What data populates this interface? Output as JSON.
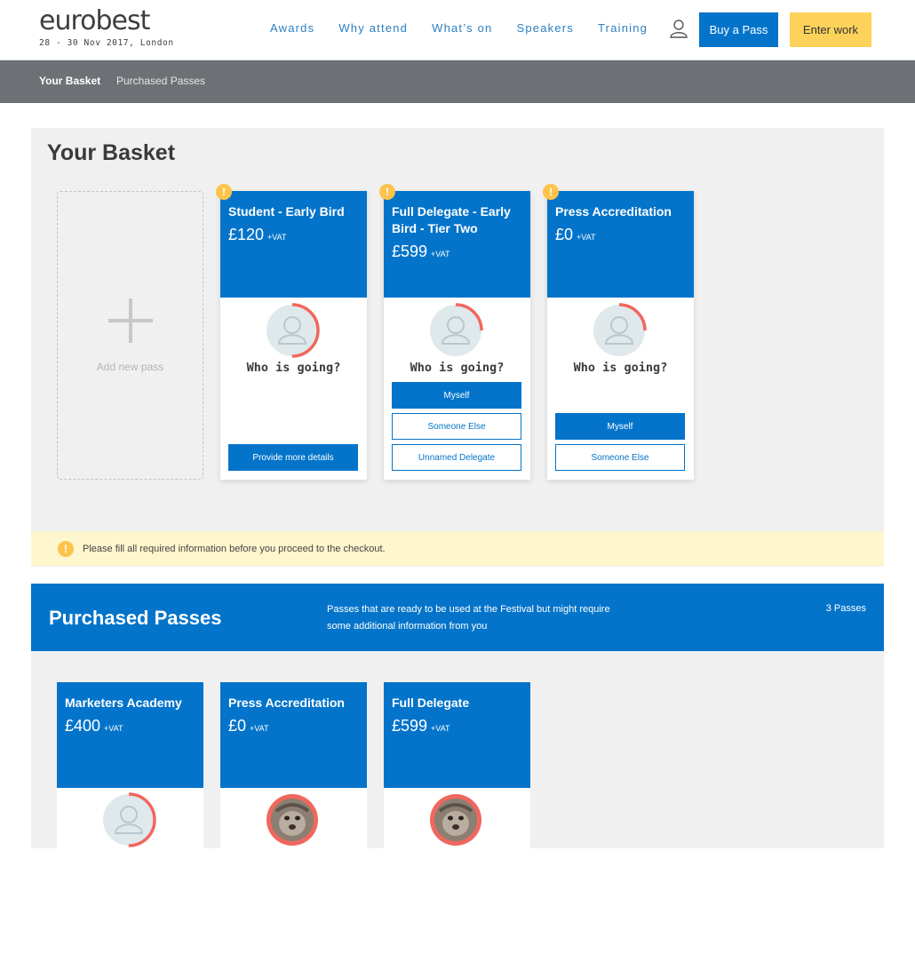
{
  "header": {
    "logo_text": "eurobest",
    "logo_sub": "28 - 30 Nov 2017, London",
    "nav": [
      "Awards",
      "Why attend",
      "What’s on",
      "Speakers",
      "Training"
    ],
    "buy_label": "Buy a Pass",
    "enter_label": "Enter work",
    "user_icon": "user-icon"
  },
  "subnav": {
    "items": [
      "Your Basket",
      "Purchased Passes"
    ]
  },
  "basket": {
    "title": "Your Basket",
    "add_label": "Add new pass",
    "cards": [
      {
        "name": "Student - Early Bird",
        "price": "£120",
        "vat": "+VAT",
        "who": "Who is going?",
        "progress": 0.5,
        "buttons": [
          {
            "label": "Provide more details",
            "style": "fill"
          }
        ]
      },
      {
        "name": "Full Delegate - Early Bird - Tier Two",
        "price": "£599",
        "vat": "+VAT",
        "who": "Who is going?",
        "progress": 0.25,
        "buttons": [
          {
            "label": "Myself",
            "style": "fill"
          },
          {
            "label": "Someone Else",
            "style": "outline"
          },
          {
            "label": "Unnamed Delegate",
            "style": "outline"
          }
        ]
      },
      {
        "name": "Press Accreditation",
        "price": "£0",
        "vat": "+VAT",
        "who": "Who is going?",
        "progress": 0.25,
        "buttons": [
          {
            "label": "Myself",
            "style": "fill"
          },
          {
            "label": "Someone Else",
            "style": "outline"
          }
        ]
      }
    ],
    "notice": "Please fill all required information before you proceed to the checkout."
  },
  "purchased": {
    "title": "Purchased Passes",
    "description": "Passes that are ready to be used at the Festival but might require some additional information from you",
    "count": "3 Passes",
    "cards": [
      {
        "name": "Marketers Academy",
        "price": "£400",
        "vat": "+VAT",
        "progress": 0.5,
        "avatar": "placeholder"
      },
      {
        "name": "Press Accreditation",
        "price": "£0",
        "vat": "+VAT",
        "progress": 1.0,
        "avatar": "photo"
      },
      {
        "name": "Full Delegate",
        "price": "£599",
        "vat": "+VAT",
        "progress": 1.0,
        "avatar": "photo"
      }
    ]
  },
  "colors": {
    "brand_blue": "#0474ca",
    "accent_yellow": "#fdd25b",
    "warning": "#fdc34b",
    "progress_ring": "#f0675e"
  }
}
